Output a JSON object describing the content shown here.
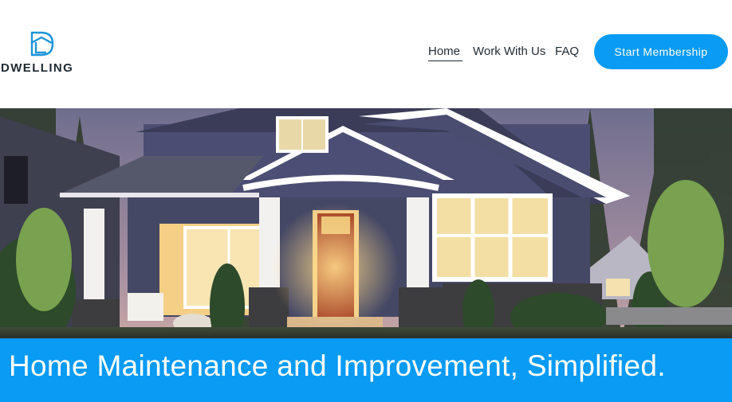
{
  "brand": {
    "name": "DWELLING",
    "logo_icon": "house-d-icon",
    "color": "#1a95d8"
  },
  "nav": {
    "items": [
      {
        "label": "Home",
        "active": true
      },
      {
        "label": "Work With Us",
        "active": false
      },
      {
        "label": "FAQ",
        "active": false
      }
    ],
    "cta_label": "Start Membership"
  },
  "hero": {
    "image": "house-exterior-photo"
  },
  "banner": {
    "headline": "Home Maintenance and Improvement, Simplified."
  },
  "colors": {
    "accent": "#0a9bf5",
    "text": "#1f2a33"
  }
}
